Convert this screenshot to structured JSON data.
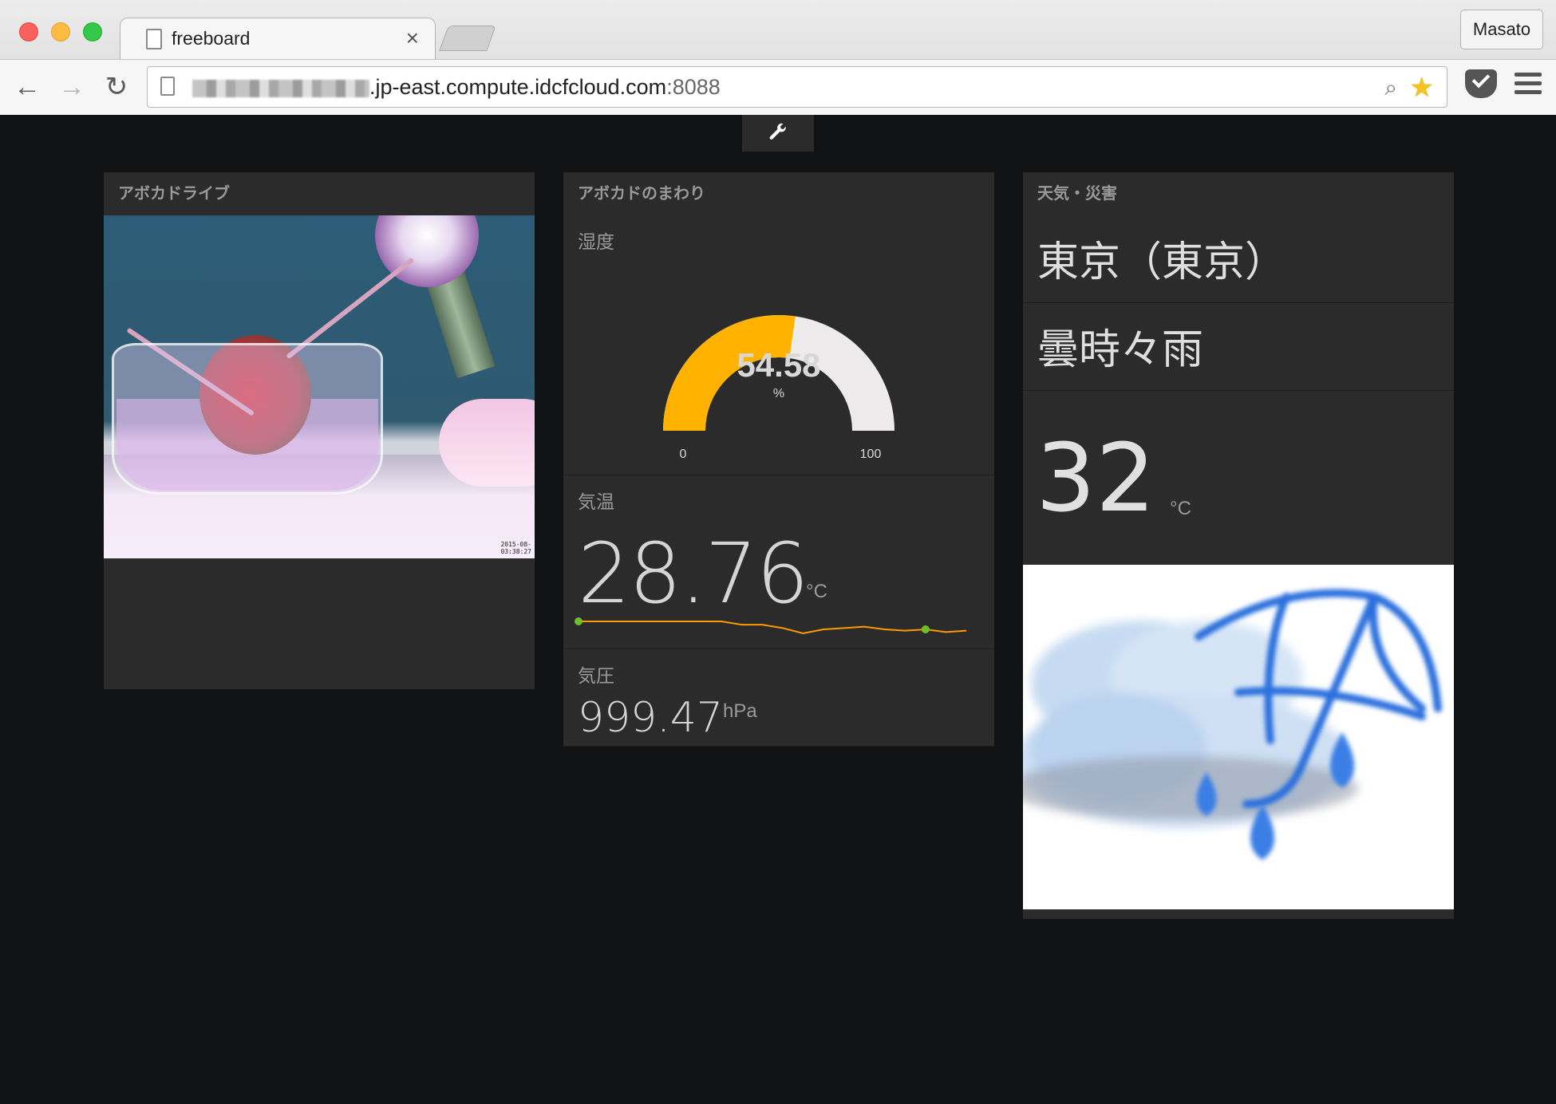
{
  "browser": {
    "tab_title": "freeboard",
    "tab_close": "×",
    "profile": "Masato",
    "url_host_suffix": ".jp-east.compute.idcfcloud.com",
    "url_port": ":8088",
    "back_glyph": "←",
    "forward_glyph": "→",
    "reload_glyph": "↻",
    "search_glyph": "⌕",
    "star_glyph": "★"
  },
  "freeboard": {
    "settings_glyph": "🔧",
    "panes": [
      {
        "title": "アボカドライブ",
        "widget": {
          "type": "picture",
          "timestamp": "2015-08-\n03:38:27"
        }
      },
      {
        "title": "アボカドのまわり",
        "humidity": {
          "title": "湿度",
          "value": "54.58",
          "units": "%",
          "min": "0",
          "max": "100",
          "fraction": 0.5458
        },
        "temperature": {
          "title": "気温",
          "value": "28.76",
          "units": "°C",
          "sparkline": [
            28.9,
            28.9,
            28.9,
            28.9,
            28.9,
            28.9,
            28.9,
            28.9,
            28.85,
            28.85,
            28.8,
            28.72,
            28.78,
            28.8,
            28.82,
            28.78,
            28.76,
            28.78,
            28.74,
            28.76
          ]
        },
        "pressure": {
          "title": "気圧",
          "value": "999.47",
          "units": "hPa"
        }
      },
      {
        "title": "天気・災害",
        "location": "東京（東京）",
        "forecast": "曇時々雨",
        "temperature": {
          "value": "32",
          "units": "°C"
        },
        "icon": "cloud-umbrella-rain-icon"
      }
    ]
  },
  "colors": {
    "gauge_fill": "#ffb300",
    "gauge_bg": "#edebeb",
    "sparkline": "#ff9900",
    "spark_dot": "#6fbf2c",
    "background": "#101214",
    "pane": "#2b2b2b"
  }
}
